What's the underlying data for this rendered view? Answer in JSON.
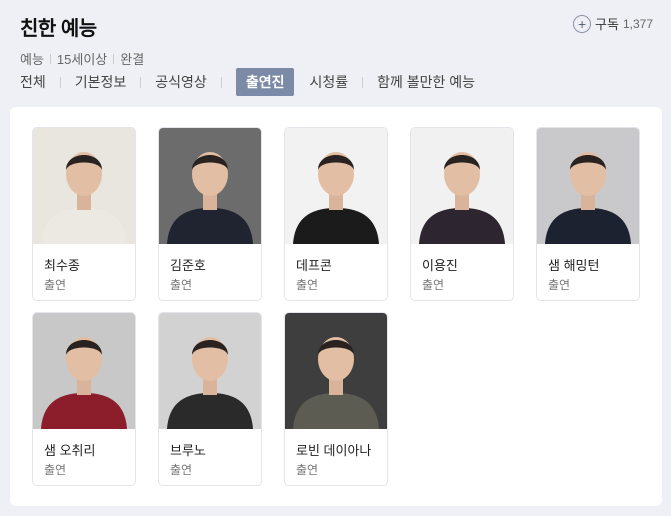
{
  "header": {
    "title": "친한 예능",
    "meta": [
      "예능",
      "15세이상",
      "완결"
    ],
    "subscribe_label": "구독",
    "subscribe_count": "1,377",
    "plus_icon": "+"
  },
  "tabs": [
    {
      "label": "전체",
      "active": false
    },
    {
      "label": "기본정보",
      "active": false
    },
    {
      "label": "공식영상",
      "active": false
    },
    {
      "label": "출연진",
      "active": true
    },
    {
      "label": "시청률",
      "active": false
    },
    {
      "label": "함께 볼만한 예능",
      "active": false
    }
  ],
  "cast": [
    {
      "name": "최수종",
      "role": "출연",
      "bg": "#e9e6e0",
      "shirt": "#ece9e2"
    },
    {
      "name": "김준호",
      "role": "출연",
      "bg": "#6c6c6c",
      "shirt": "#1f2430"
    },
    {
      "name": "데프콘",
      "role": "출연",
      "bg": "#f2f2f2",
      "shirt": "#1b1b1b"
    },
    {
      "name": "이용진",
      "role": "출연",
      "bg": "#f1f1f1",
      "shirt": "#2d2530"
    },
    {
      "name": "샘 해밍턴",
      "role": "출연",
      "bg": "#c9c9cb",
      "shirt": "#1d2231"
    },
    {
      "name": "샘 오취리",
      "role": "출연",
      "bg": "#c8c8c8",
      "shirt": "#8b1e2a"
    },
    {
      "name": "브루노",
      "role": "출연",
      "bg": "#d2d2d2",
      "shirt": "#2a2a2a"
    },
    {
      "name": "로빈 데이아나",
      "role": "출연",
      "bg": "#3e3e3e",
      "shirt": "#5c5c52"
    }
  ]
}
